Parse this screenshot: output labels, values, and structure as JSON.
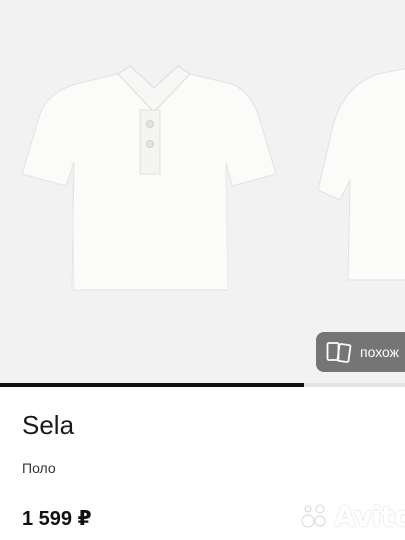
{
  "listing": {
    "brand": "Sela",
    "category": "Поло",
    "price": "1 599 ₽"
  },
  "gallery": {
    "similar_button_label": "похож",
    "progress_fraction": 0.75,
    "colors": {
      "background": "#f2f2f2",
      "overlay": "#6b6b6b",
      "progress": "#111111"
    }
  },
  "watermark": {
    "text": "Avito"
  }
}
